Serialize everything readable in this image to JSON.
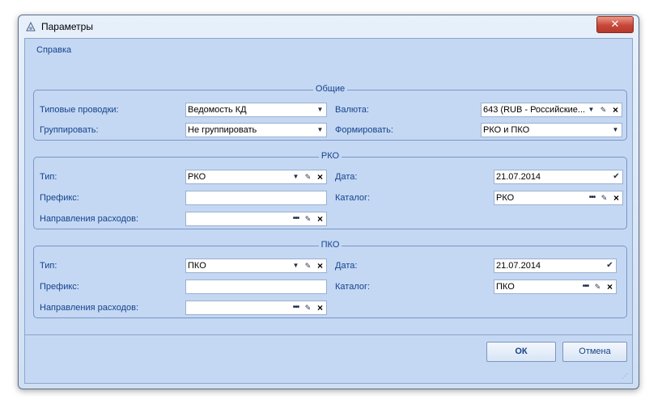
{
  "window": {
    "title": "Параметры",
    "close_glyph": "✕"
  },
  "menu": {
    "help": "Справка"
  },
  "general": {
    "title": "Общие",
    "typical_label": "Типовые проводки:",
    "typical_value": "Ведомость КД",
    "currency_label": "Валюта:",
    "currency_value": "643 (RUB - Российские...",
    "group_label": "Группировать:",
    "group_value": "Не группировать",
    "form_label": "Формировать:",
    "form_value": "РКО и ПКО"
  },
  "rko": {
    "title": "РКО",
    "type_label": "Тип:",
    "type_value": "РКО",
    "date_label": "Дата:",
    "date_value": "21.07.2014",
    "prefix_label": "Префикс:",
    "prefix_value": "",
    "catalog_label": "Каталог:",
    "catalog_value": "РКО",
    "direction_label": "Направления расходов:",
    "direction_value": ""
  },
  "pko": {
    "title": "ПКО",
    "type_label": "Тип:",
    "type_value": "ПКО",
    "date_label": "Дата:",
    "date_value": "21.07.2014",
    "prefix_label": "Префикс:",
    "prefix_value": "",
    "catalog_label": "Каталог:",
    "catalog_value": "ПКО",
    "direction_label": "Направления расходов:",
    "direction_value": ""
  },
  "buttons": {
    "ok": "ОК",
    "cancel": "Отмена"
  },
  "icons": {
    "dropdown": "chevron-down-icon",
    "edit": "pencil-icon",
    "clear": "close-icon",
    "browse": "ellipsis-icon",
    "calendar": "check-icon"
  }
}
